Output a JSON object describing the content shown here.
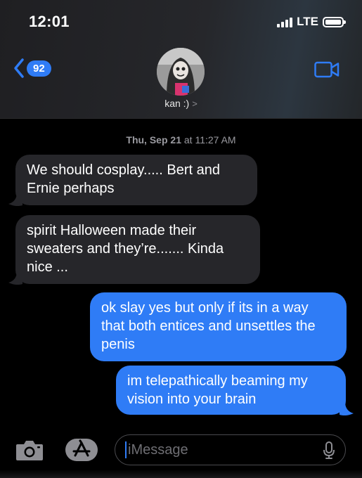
{
  "status_bar": {
    "time": "12:01",
    "carrier": "LTE"
  },
  "header": {
    "back_count": "92",
    "contact_name": "kan :)",
    "chevron": ">"
  },
  "conversation": {
    "timestamp_day": "Thu, Sep 21",
    "timestamp_at": " at ",
    "timestamp_time": "11:27 AM",
    "messages": [
      {
        "direction": "incoming",
        "text": "We should cosplay..... Bert and Ernie perhaps"
      },
      {
        "direction": "incoming",
        "text": "spirit Halloween made their sweaters and they’re....... Kinda nice ..."
      },
      {
        "direction": "outgoing",
        "text": "ok slay yes but only if its in a way that both entices and unsettles the penis"
      },
      {
        "direction": "outgoing",
        "text": "im telepathically beaming my vision into your brain"
      }
    ]
  },
  "composer": {
    "placeholder": "iMessage"
  },
  "icons": {
    "back": "chevron-left-icon",
    "video": "video-camera-icon",
    "camera": "camera-icon",
    "apps": "app-store-icon",
    "mic": "microphone-icon"
  },
  "colors": {
    "accent": "#2f7cf6",
    "incoming_bubble": "#26262a",
    "background": "#000000"
  }
}
